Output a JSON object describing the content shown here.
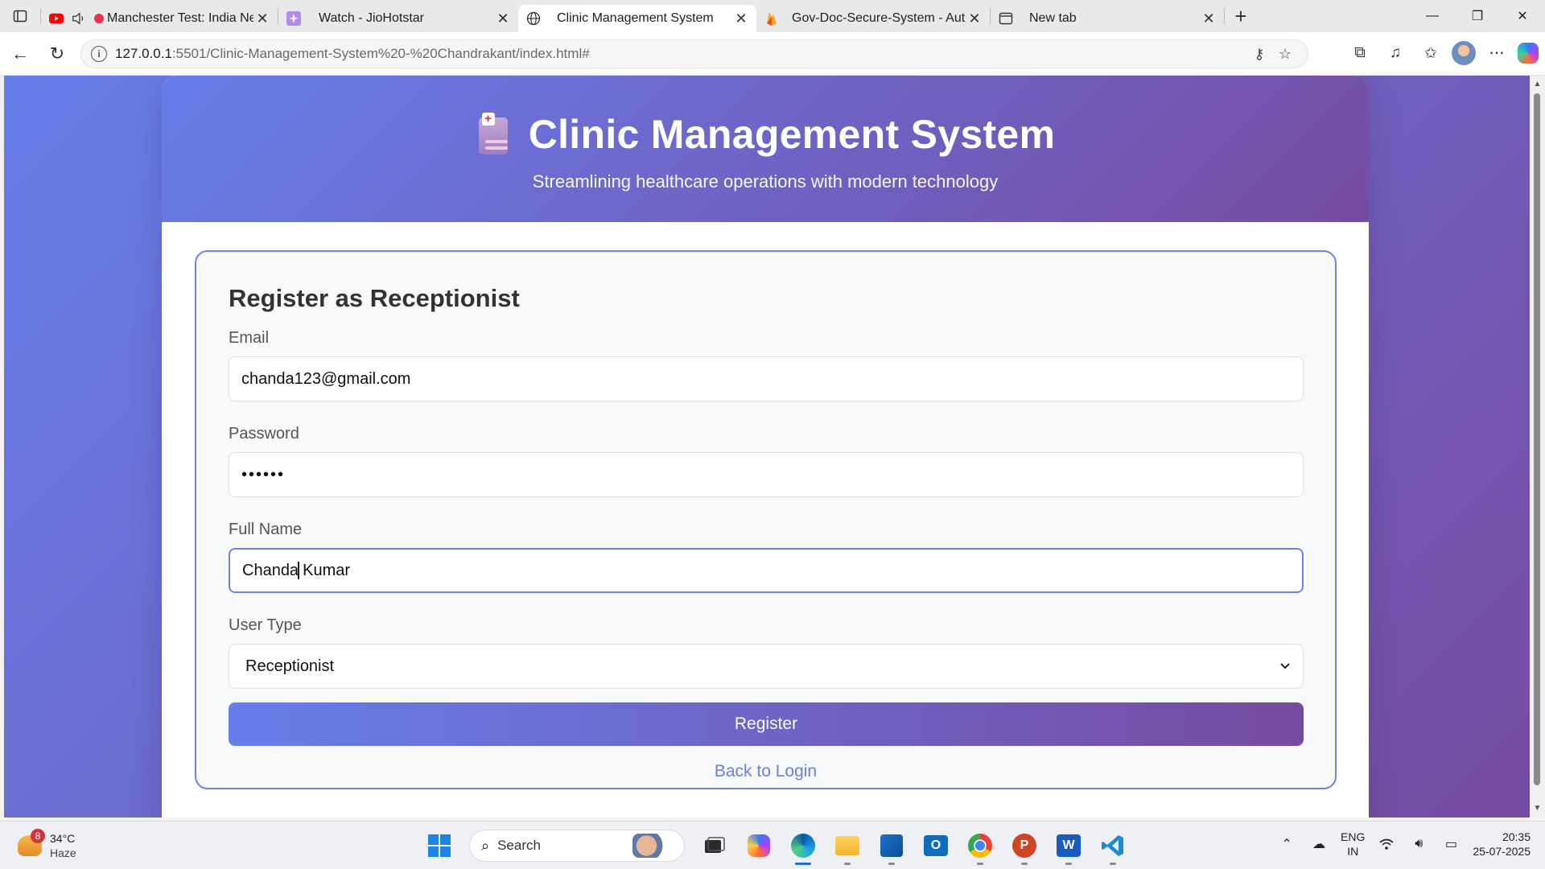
{
  "browser": {
    "tabs": [
      {
        "label": "Manchester Test: India Ne",
        "favicon": "youtube-icon",
        "muted_icon": "speaker-icon",
        "active": false
      },
      {
        "label": "Watch - JioHotstar",
        "favicon": "hotstar-icon",
        "active": false
      },
      {
        "label": "Clinic Management System",
        "favicon": "globe-icon",
        "active": true
      },
      {
        "label": "Gov-Doc-Secure-System - Authen",
        "favicon": "firebase-icon",
        "active": false
      },
      {
        "label": "New tab",
        "favicon": "newtab-icon",
        "active": false
      }
    ],
    "address": {
      "host": "127.0.0.1",
      "path": ":5501/Clinic-Management-System%20-%20Chandrakant/index.html#"
    }
  },
  "page": {
    "header": {
      "title": "Clinic Management System",
      "subtitle": "Streamlining healthcare operations with modern technology"
    },
    "form": {
      "heading": "Register as Receptionist",
      "email_label": "Email",
      "email_value": "chanda123@gmail.com",
      "password_label": "Password",
      "password_mask": "••••••",
      "fullname_label": "Full Name",
      "fullname_before_cursor": "Chanda",
      "fullname_after_cursor": " Kumar",
      "usertype_label": "User Type",
      "usertype_value": "Receptionist",
      "submit_label": "Register",
      "back_link": "Back to Login"
    },
    "colors": {
      "gradient_start": "#667eea",
      "gradient_end": "#764ba2",
      "link": "#6a7fe0"
    }
  },
  "taskbar": {
    "weather": {
      "temp": "34°C",
      "condition": "Haze",
      "badge": "8"
    },
    "search_placeholder": "Search",
    "language": {
      "line1": "ENG",
      "line2": "IN"
    },
    "clock": {
      "time": "20:35",
      "date": "25-07-2025"
    }
  }
}
